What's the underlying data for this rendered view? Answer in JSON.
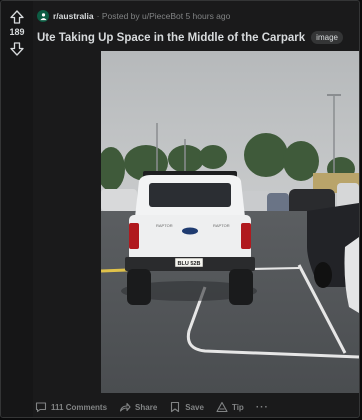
{
  "post": {
    "score": "189",
    "subreddit": "r/australia",
    "byline": "· Posted by u/PieceBot 5 hours ago",
    "title": "Ute Taking Up Space in the Middle of the Carpark",
    "flair": "image",
    "plate": "BLU 52B"
  },
  "actions": {
    "comments": "111 Comments",
    "share": "Share",
    "save": "Save",
    "tip": "Tip",
    "more": "···"
  },
  "colors": {
    "card": "#1a1a1b",
    "upvote": "#d7dadc",
    "subreddit_icon": "#0d5c43"
  }
}
